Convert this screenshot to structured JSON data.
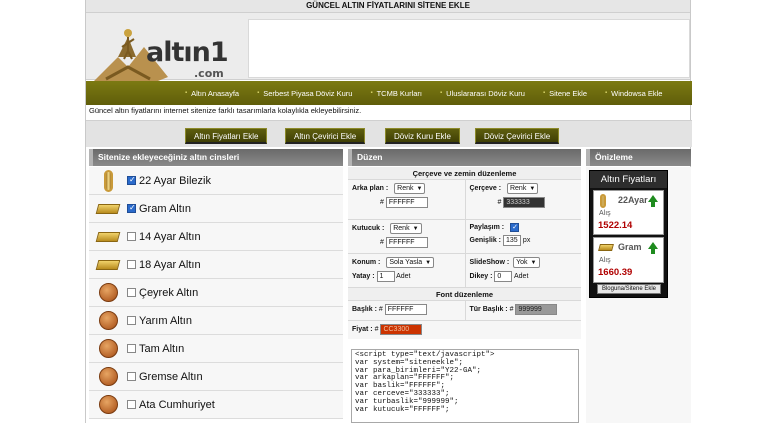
{
  "topbar": {
    "title": "GÜNCEL ALTIN FİYATLARINI SİTENE EKLE"
  },
  "logo": {
    "text_main": "altın1",
    "text_sub": ".com"
  },
  "nav": [
    {
      "label": "Altın Anasayfa"
    },
    {
      "label": "Serbest Piyasa Döviz Kuru"
    },
    {
      "label": "TCMB Kurları"
    },
    {
      "label": "Uluslararası Döviz Kuru"
    },
    {
      "label": "Sitene Ekle"
    },
    {
      "label": "Windowsa Ekle"
    }
  ],
  "description": "Güncel altın fiyatlarını internet sitenize farklı tasarımlarla kolaylıkla ekleyebilirsiniz.",
  "tabs": [
    {
      "label": "Altın Fiyatları Ekle"
    },
    {
      "label": "Altın Çevirici Ekle"
    },
    {
      "label": "Döviz Kuru Ekle"
    },
    {
      "label": "Döviz Çevirici Ekle"
    }
  ],
  "left_panel": {
    "title": "Sitenize ekleyeceğiniz altın cinsleri",
    "items": [
      {
        "label": "22 Ayar Bilezik",
        "checked": true,
        "icon": "bracelet-icon"
      },
      {
        "label": "Gram Altın",
        "checked": true,
        "icon": "gold-bar-icon"
      },
      {
        "label": "14 Ayar Altın",
        "checked": false,
        "icon": "gold-bar-icon"
      },
      {
        "label": "18 Ayar Altın",
        "checked": false,
        "icon": "gold-bar-icon"
      },
      {
        "label": "Çeyrek Altın",
        "checked": false,
        "icon": "gold-coin-icon"
      },
      {
        "label": "Yarım Altın",
        "checked": false,
        "icon": "gold-coin-icon"
      },
      {
        "label": "Tam Altın",
        "checked": false,
        "icon": "gold-coin-icon"
      },
      {
        "label": "Gremse Altın",
        "checked": false,
        "icon": "gold-coin-icon"
      },
      {
        "label": "Ata Cumhuriyet",
        "checked": false,
        "icon": "gold-coin-icon"
      }
    ]
  },
  "mid_panel": {
    "title": "Düzen",
    "section1": "Çerçeve ve zemin düzenleme",
    "arka_plan": {
      "label": "Arka plan :",
      "select": "Renk",
      "hash": "#",
      "value": "FFFFFF"
    },
    "cerceve": {
      "label": "Çerçeve :",
      "select": "Renk",
      "hash": "#",
      "value": "333333"
    },
    "kutucuk": {
      "label": "Kutucuk :",
      "select": "Renk",
      "hash": "#",
      "value": "FFFFFF"
    },
    "paylasim": {
      "label": "Paylaşım :",
      "checked": true
    },
    "genislik": {
      "label": "Genişlik :",
      "value": "135",
      "unit": "px"
    },
    "konum": {
      "label": "Konum :",
      "select": "Sola Yasla"
    },
    "yatay": {
      "label": "Yatay :",
      "value": "1",
      "unit": "Adet"
    },
    "slideshow": {
      "label": "SlideShow :",
      "select": "Yok"
    },
    "dikey": {
      "label": "Dikey :",
      "value": "0",
      "unit": "Adet"
    },
    "section2": "Font düzenleme",
    "baslik": {
      "label": "Başlık :",
      "hash": "#",
      "value": "FFFFFF"
    },
    "tur_baslik": {
      "label": "Tür Başlık :",
      "hash": "#",
      "value": "999999"
    },
    "fiyat": {
      "label": "Fiyat :",
      "hash": "#",
      "value": "CC3300"
    },
    "code_text": "<script type=\"text/javascript\">\nvar system=\"siteneekle\";\nvar para_birimleri=\"Y22-GA\";\nvar arkaplan=\"FFFFFF\";\nvar baslik=\"FFFFFF\";\nvar cerceve=\"333333\";\nvar turbaslik=\"999999\";\nvar kutucuk=\"FFFFFF\";"
  },
  "right_panel": {
    "title": "Önizleme",
    "widget_title": "Altın Fiyatları",
    "cards": [
      {
        "name": "22Ayar",
        "alis_label": "Alış",
        "value": "1522.14"
      },
      {
        "name": "Gram",
        "alis_label": "Alış",
        "value": "1660.39"
      }
    ],
    "button": "Bloguna/Sitene Ekle"
  },
  "colors": {
    "nav_green": "#6f6d0f",
    "panel_head": "#777777",
    "price_red": "#b00000",
    "swatch_cerceve": "#333333",
    "swatch_tur_baslik": "#999999",
    "swatch_fiyat": "#CC3300"
  }
}
